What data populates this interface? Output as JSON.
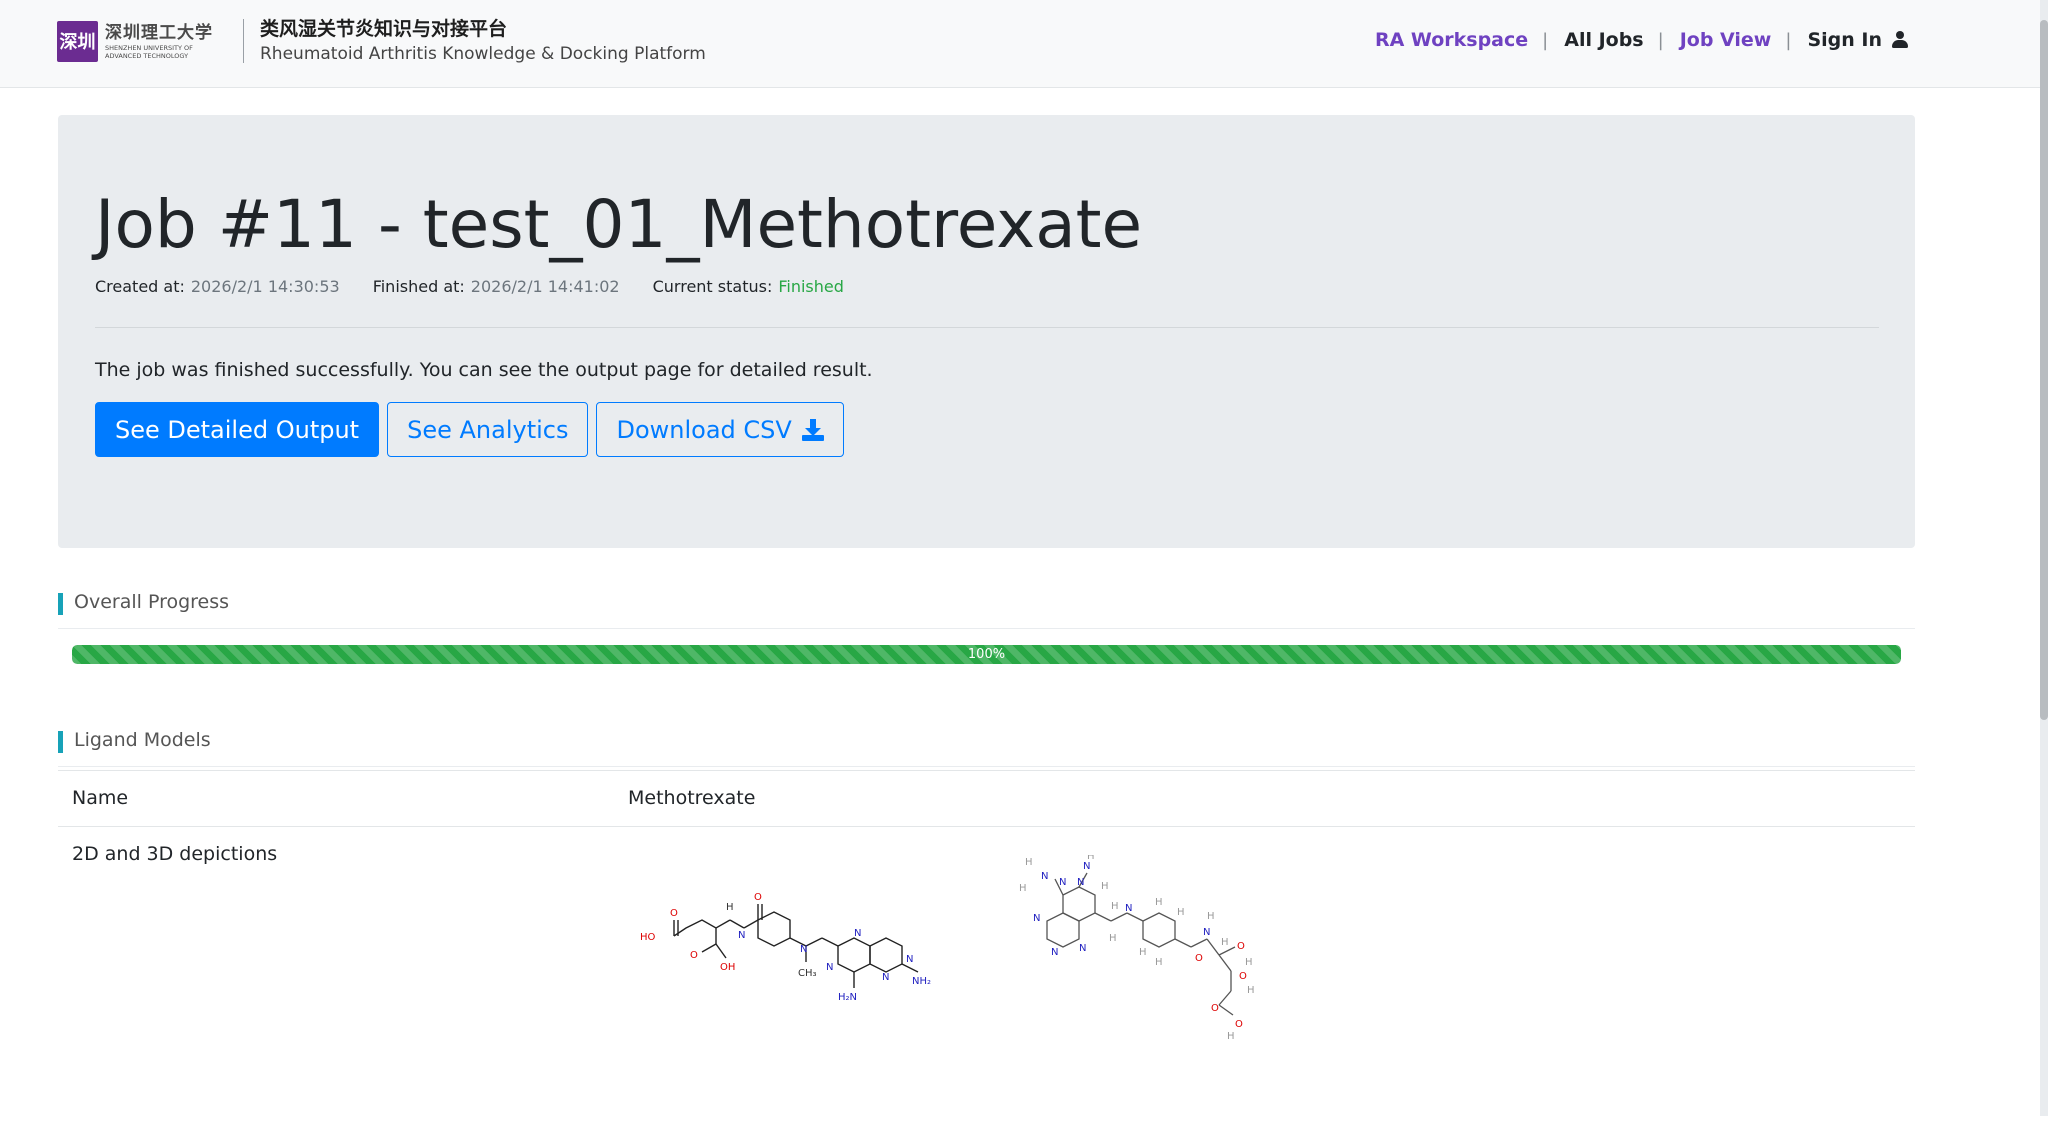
{
  "header": {
    "logo": {
      "mark": "深圳",
      "name_cn": "深圳理工大学",
      "name_en_1": "SHENZHEN UNIVERSITY OF",
      "name_en_2": "ADVANCED TECHNOLOGY"
    },
    "title_cn": "类风湿关节炎知识与对接平台",
    "title_en": "Rheumatoid Arthritis Knowledge & Docking Platform",
    "nav": {
      "workspace": "RA Workspace",
      "all_jobs": "All Jobs",
      "job_view": "Job View",
      "sign_in": "Sign In",
      "separator": "|"
    }
  },
  "job": {
    "title": "Job #11 - test_01_Methotrexate",
    "created_label": "Created at:",
    "created_value": "2026/2/1 14:30:53",
    "finished_label": "Finished at:",
    "finished_value": "2026/2/1 14:41:02",
    "status_label": "Current status:",
    "status_value": "Finished",
    "message": "The job was finished successfully. You can see the output page for detailed result.",
    "buttons": {
      "detailed": "See Detailed Output",
      "analytics": "See Analytics",
      "download": "Download CSV"
    }
  },
  "progress": {
    "heading": "Overall Progress",
    "value": 100,
    "label": "100%"
  },
  "ligands": {
    "heading": "Ligand Models",
    "rows": {
      "name_key": "Name",
      "name_value": "Methotrexate",
      "depiction_key": "2D and 3D depictions"
    }
  },
  "colors": {
    "accent_purple": "#6f42c1",
    "primary": "#007bff",
    "success": "#28a745",
    "section_bar": "#17a2b8"
  }
}
